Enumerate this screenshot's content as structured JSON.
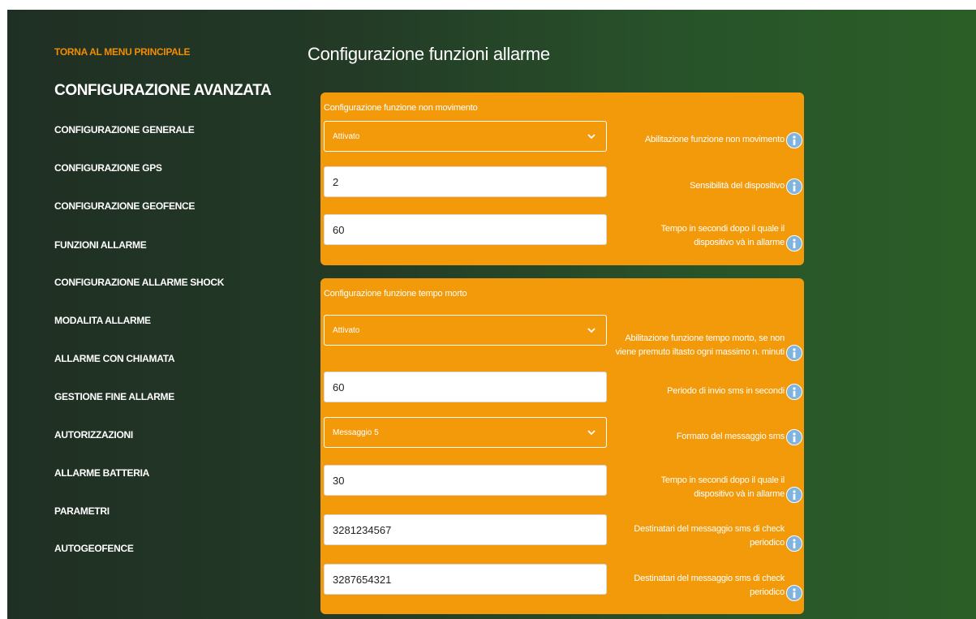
{
  "sidebar": {
    "back_link": "TORNA AL MENU PRINCIPALE",
    "heading": "CONFIGURAZIONE AVANZATA",
    "items": [
      {
        "label": "CONFIGURAZIONE GENERALE"
      },
      {
        "label": "CONFIGURAZIONE GPS"
      },
      {
        "label": "CONFIGURAZIONE GEOFENCE"
      },
      {
        "label": "FUNZIONI ALLARME"
      },
      {
        "label": "CONFIGURAZIONE ALLARME SHOCK"
      },
      {
        "label": "MODALITA ALLARME"
      },
      {
        "label": "ALLARME CON CHIAMATA"
      },
      {
        "label": "GESTIONE FINE ALLARME"
      },
      {
        "label": "AUTORIZZAZIONI"
      },
      {
        "label": "ALLARME BATTERIA"
      },
      {
        "label": "PARAMETRI"
      },
      {
        "label": "AUTOGEOFENCE"
      }
    ]
  },
  "main": {
    "title": "Configurazione funzioni allarme",
    "panels": [
      {
        "title": "Configurazione funzione non movimento",
        "fields": [
          {
            "type": "select",
            "value": "Attivato",
            "description": "Abilitazione funzione non movimento"
          },
          {
            "type": "text",
            "value": "2",
            "description": "Sensibilità del dispositivo"
          },
          {
            "type": "text",
            "value": "60",
            "description": "Tempo in secondi dopo il quale il dispositivo và in allarme"
          }
        ]
      },
      {
        "title": "Configurazione funzione tempo morto",
        "fields": [
          {
            "type": "select",
            "value": "Attivato",
            "description": "Abilitazione funzione tempo morto, se non viene premuto iltasto ogni massimo n. minuti"
          },
          {
            "type": "text",
            "value": "60",
            "description": "Periodo di invio sms in secondi"
          },
          {
            "type": "select",
            "value": "Messaggio 5",
            "description": "Formato del messaggio sms"
          },
          {
            "type": "text",
            "value": "30",
            "description": "Tempo in secondi dopo il quale il dispositivo và in allarme"
          },
          {
            "type": "text",
            "value": "3281234567",
            "description": "Destinatari del messaggio sms di check periodico"
          },
          {
            "type": "text",
            "value": "3287654321",
            "description": "Destinatari del messaggio sms di check periodico"
          }
        ]
      }
    ]
  },
  "icons": {
    "info": "info-icon",
    "chevron": "chevron-down-icon"
  },
  "colors": {
    "accent": "#f28c00",
    "panel": "#f39a0a",
    "info": "#7fb4de"
  }
}
